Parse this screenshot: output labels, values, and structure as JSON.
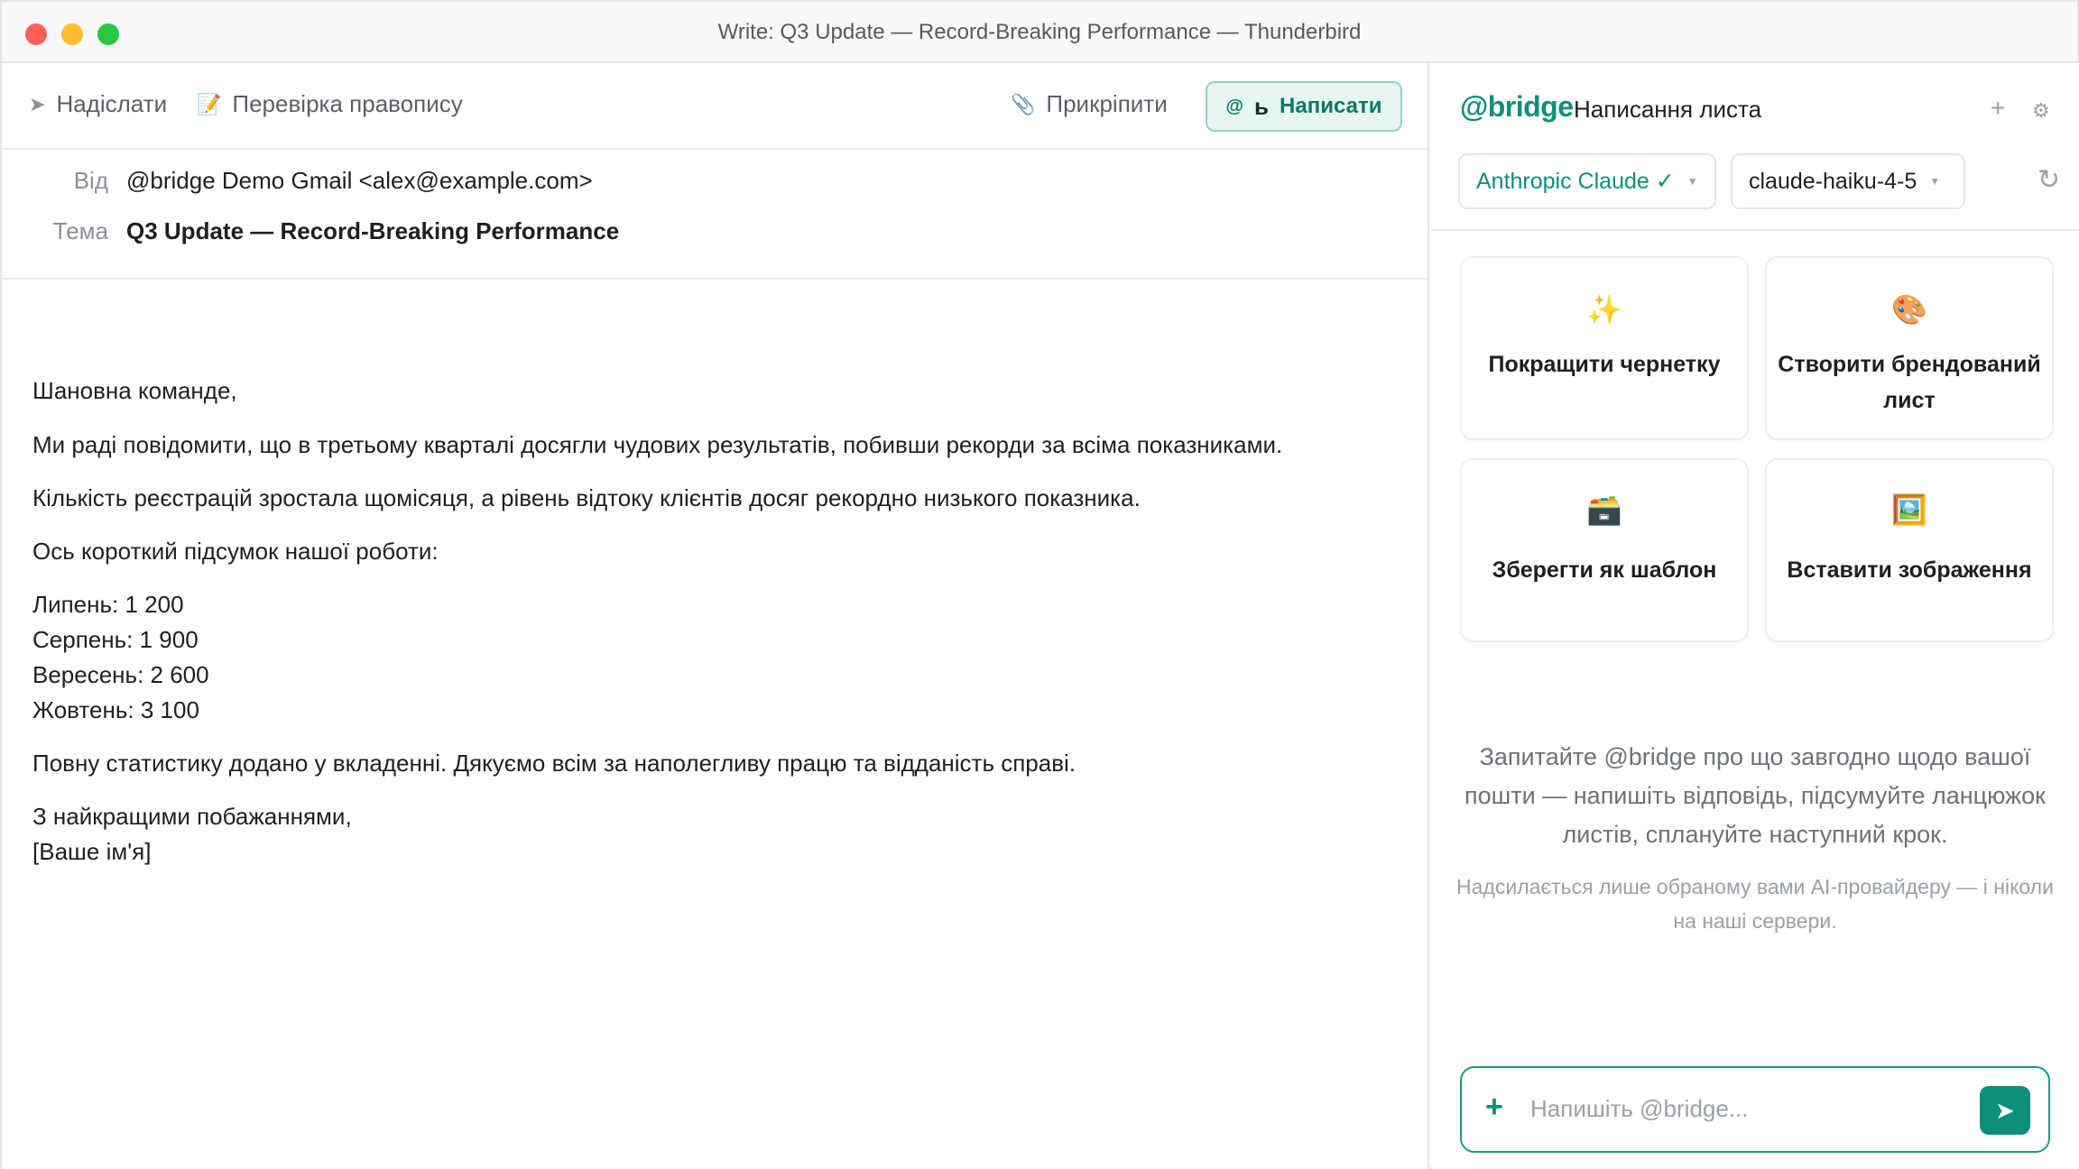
{
  "window": {
    "title": "Write: Q3 Update — Record-Breaking Performance — Thunderbird"
  },
  "toolbar": {
    "send": "Надіслати",
    "spellcheck": "Перевірка правопису",
    "attach": "Прикріпити",
    "write_prefix": "ь",
    "write": "Написати"
  },
  "headers": {
    "from_label": "Від",
    "from_value": "@bridge Demo Gmail <alex@example.com>",
    "subject_label": "Тема",
    "subject_value": "Q3 Update — Record-Breaking Performance"
  },
  "body": {
    "greeting": "Шановна команде,",
    "p1": "Ми раді повідомити, що в третьому кварталі досягли чудових результатів, побивши рекорди за всіма показниками.",
    "p2": "Кількість реєстрацій зростала щомісяця, а рівень відтоку клієнтів досяг рекордно низького показника.",
    "p3": "Ось короткий підсумок нашої роботи:",
    "stats": [
      "Липень: 1 200",
      "Серпень: 1 900",
      "Вересень: 2 600",
      "Жовтень: 3 100"
    ],
    "p4": "Повну статистику додано у вкладенні. Дякуємо всім за наполегливу працю та відданість справі.",
    "closing": "З найкращими побажаннями,",
    "signature": "[Ваше ім'я]"
  },
  "sidebar": {
    "brand": "@bridge",
    "title": "Написання листа",
    "provider": "Anthropic Claude ✓",
    "model": "claude-haiku-4-5",
    "actions": [
      {
        "icon": "✨",
        "label": "Покращити чернетку"
      },
      {
        "icon": "🎨",
        "label": "Створити брендований лист"
      },
      {
        "icon": "🗃️",
        "label": "Зберегти як шаблон"
      },
      {
        "icon": "🖼️",
        "label": "Вставити зображення"
      }
    ],
    "hint": "Запитайте @bridge про що завгодно щодо вашої пошти — напишіть відповідь, підсумуйте ланцюжок листів, сплануйте наступний крок.",
    "privacy": "Надсилається лише обраному вами AI-провайдеру — і ніколи на наші сервери.",
    "chat_placeholder": "Напишіть @bridge..."
  },
  "colors": {
    "accent": "#0e8f7a",
    "accent_bg": "#e7f6f3"
  }
}
